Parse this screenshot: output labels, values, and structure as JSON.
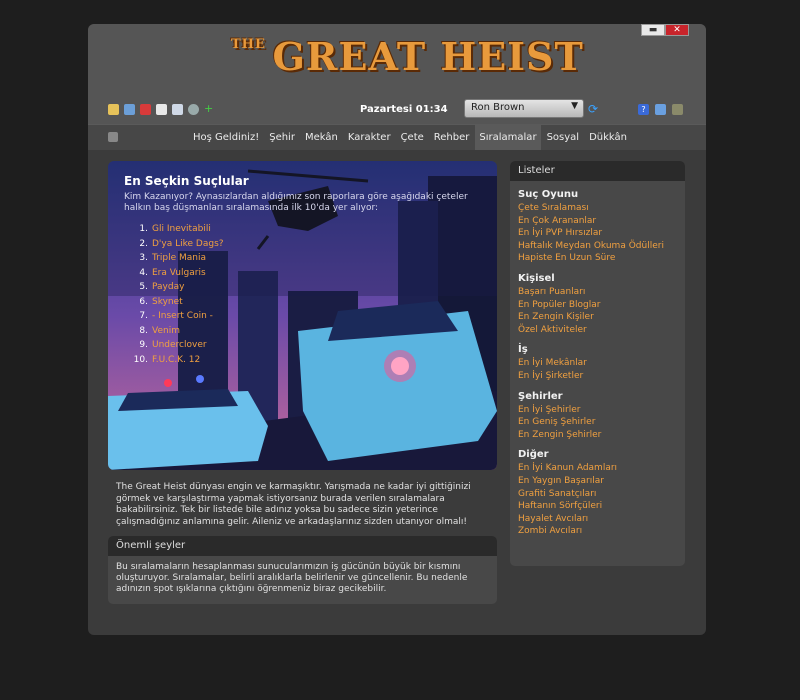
{
  "window": {
    "minimize": "▬",
    "close": "✕"
  },
  "logo": {
    "the": "THE",
    "main": "GREAT HEIST"
  },
  "toolbar": {
    "icons": [
      "cards-icon",
      "network-icon",
      "pencil-icon",
      "document-icon",
      "book-icon",
      "magnifier-icon",
      "plus-icon"
    ]
  },
  "clock": "Pazartesi 01:34",
  "character": {
    "selected": "Ron Brown"
  },
  "right_icons": [
    "help-icon",
    "user-icon",
    "gang-icon"
  ],
  "nav": {
    "items": [
      "Hoş Geldiniz!",
      "Şehir",
      "Mekân",
      "Karakter",
      "Çete",
      "Rehber",
      "Sıralamalar",
      "Sosyal",
      "Dükkân"
    ],
    "active": 6
  },
  "hero": {
    "title": "En Seçkin Suçlular",
    "subtitle": "Kim Kazanıyor? Aynasızlardan aldığımız son raporlara göre aşağıdaki çeteler halkın baş düşmanları sıralamasında ilk 10'da yer alıyor:",
    "ranking": [
      {
        "num": "1.",
        "name": "Gli Inevitabili"
      },
      {
        "num": "2.",
        "name": "D'ya Like Dags?"
      },
      {
        "num": "3.",
        "name": "Triple Mania"
      },
      {
        "num": "4.",
        "name": "Era Vulgaris"
      },
      {
        "num": "5.",
        "name": "Payday"
      },
      {
        "num": "6.",
        "name": "Skynet"
      },
      {
        "num": "7.",
        "name": "- Insert Coin -"
      },
      {
        "num": "8.",
        "name": "Venim"
      },
      {
        "num": "9.",
        "name": "Underclover"
      },
      {
        "num": "10.",
        "name": "F.U.C.K. 12"
      }
    ]
  },
  "intro": "The Great Heist dünyası engin ve karmaşıktır. Yarışmada ne kadar iyi gittiğinizi görmek ve karşılaştırma yapmak istiyorsanız burada verilen sıralamalara bakabilirsiniz. Tek bir listede bile adınız yoksa bu sadece sizin yeterince çalışmadığınız anlamına gelir. Aileniz ve arkadaşlarınız sizden utanıyor olmalı!",
  "notice": {
    "title": "Önemli şeyler",
    "body": "Bu sıralamaların hesaplanması sunucularımızın iş gücünün büyük bir kısmını oluşturuyor. Sıralamalar, belirli aralıklarla belirlenir ve güncellenir. Bu nedenle adınızın spot ışıklarına çıktığını öğrenmeniz biraz gecikebilir."
  },
  "sidebar": {
    "title": "Listeler",
    "sections": [
      {
        "heading": "Suç Oyunu",
        "links": [
          "Çete Sıralaması",
          "En Çok Arananlar",
          "En İyi PVP Hırsızlar",
          "Haftalık Meydan Okuma Ödülleri",
          "Hapiste En Uzun Süre"
        ]
      },
      {
        "heading": "Kişisel",
        "links": [
          "Başarı Puanları",
          "En Popüler Bloglar",
          "En Zengin Kişiler",
          "Özel Aktiviteler"
        ]
      },
      {
        "heading": "İş",
        "links": [
          "En İyi Mekânlar",
          "En İyi Şirketler"
        ]
      },
      {
        "heading": "Şehirler",
        "links": [
          "En İyi Şehirler",
          "En Geniş Şehirler",
          "En Zengin Şehirler"
        ]
      },
      {
        "heading": "Diğer",
        "links": [
          "En İyi Kanun Adamları",
          "En Yaygın Başarılar",
          "Grafiti Sanatçıları",
          "Haftanın Sörfçüleri",
          "Hayalet Avcıları",
          "Zombi Avcıları"
        ]
      }
    ]
  },
  "colors": {
    "accent": "#f0a040",
    "background": "#1e1e1e",
    "panel": "#484848",
    "close": "#c8242b"
  }
}
